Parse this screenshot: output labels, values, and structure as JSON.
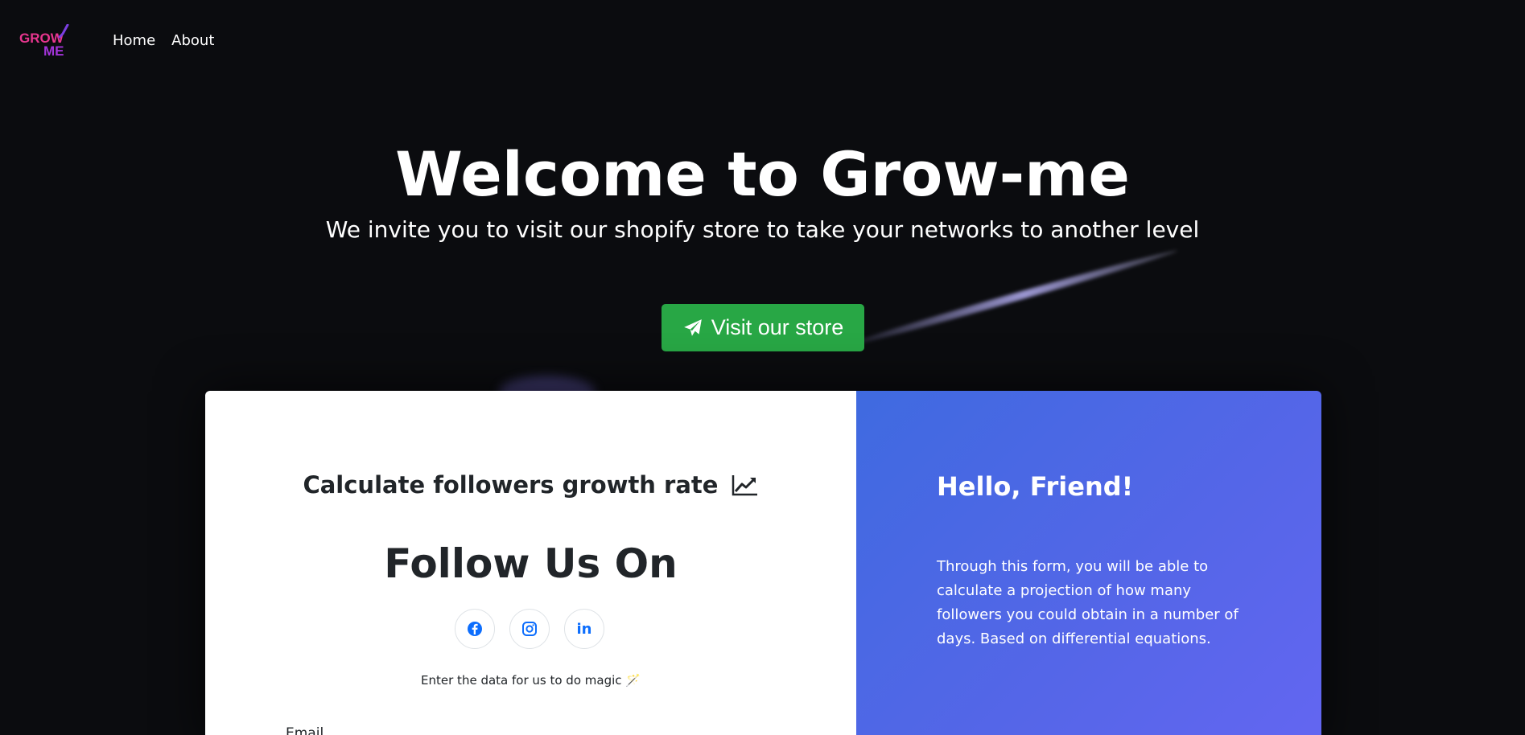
{
  "logo": {
    "line1": "GROW",
    "line2": "ME",
    "colors": [
      "#e8368f",
      "#a234d8"
    ]
  },
  "nav": {
    "items": [
      {
        "label": "Home"
      },
      {
        "label": "About"
      }
    ]
  },
  "hero": {
    "title": "Welcome to Grow-me",
    "subtitle": "We invite you to visit our shopify store to take your networks to another level",
    "button_label": "Visit our store",
    "button_icon": "paper-plane-icon",
    "button_color": "#28a745"
  },
  "form_panel": {
    "title": "Calculate followers growth rate",
    "title_icon": "chart-line-icon",
    "follow_heading": "Follow Us On",
    "social": [
      {
        "name": "facebook-icon"
      },
      {
        "name": "instagram-icon"
      },
      {
        "name": "linkedin-icon",
        "text": "in"
      }
    ],
    "instruction": "Enter the data for us to do magic 🪄",
    "email_label": "Email"
  },
  "info_panel": {
    "title": "Hello, Friend!",
    "description": "Through this form, you will be able to calculate a projection of how many followers you could obtain in a number of days. Based on differential equations.",
    "gradient": [
      "#3f6ae0",
      "#6366f1"
    ]
  }
}
